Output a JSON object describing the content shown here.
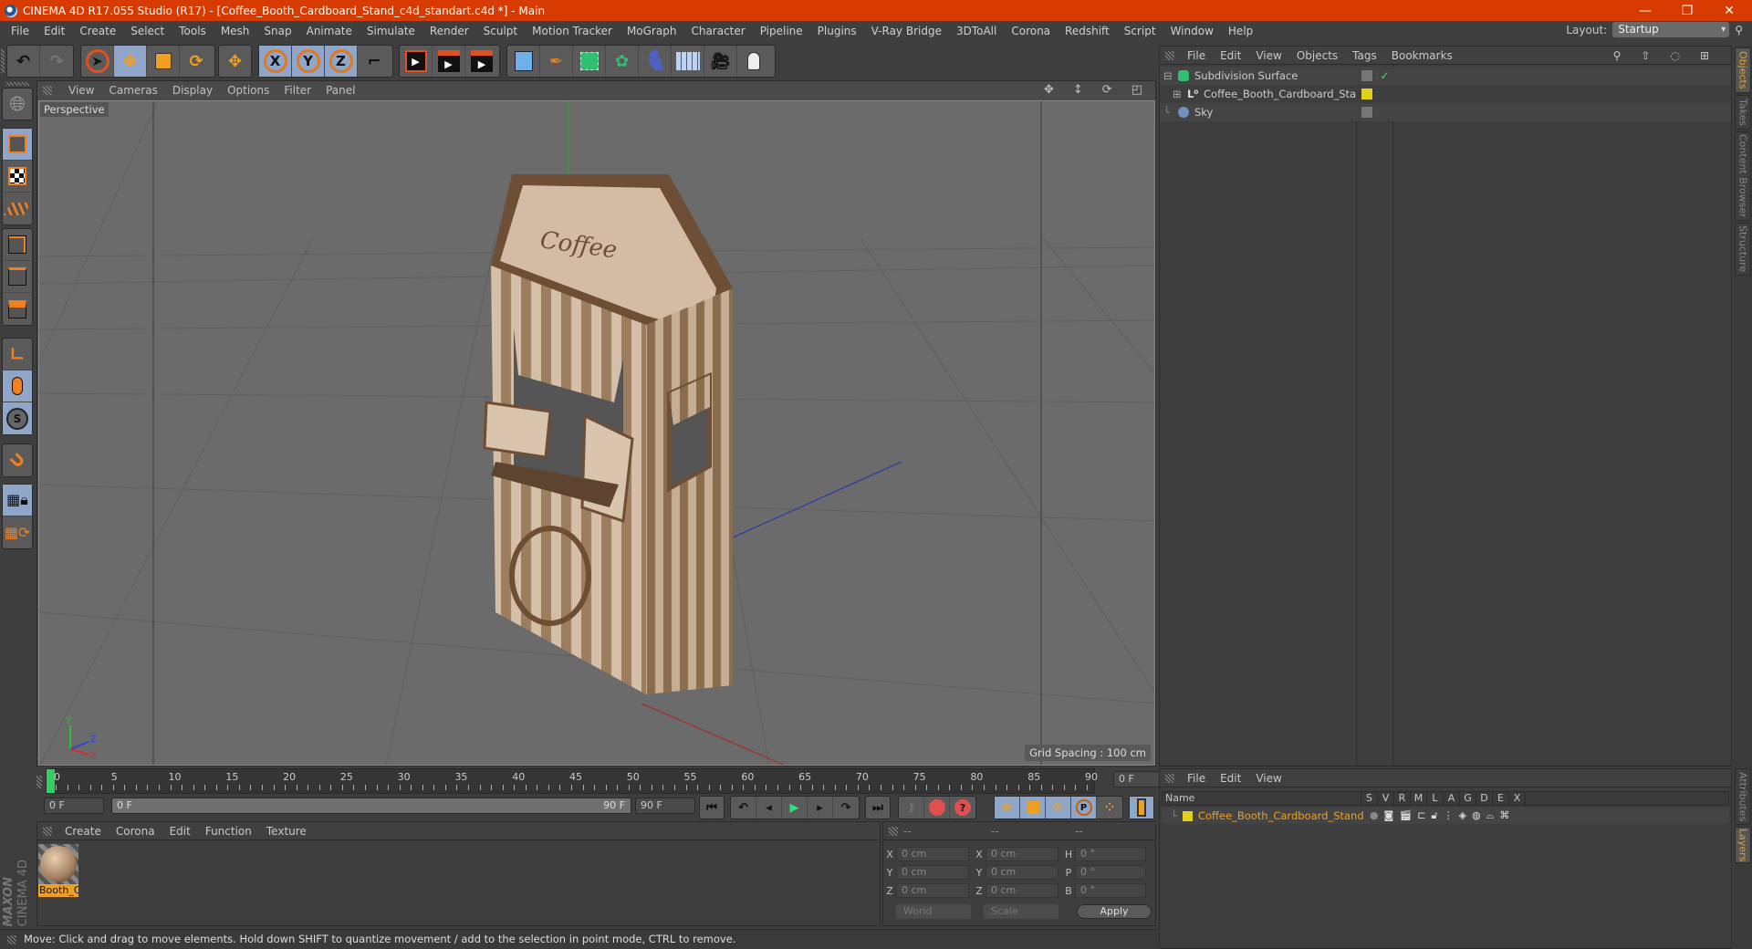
{
  "window": {
    "title": "CINEMA 4D R17.055 Studio (R17) - [Coffee_Booth_Cardboard_Stand_c4d_standart.c4d *] - Main",
    "controls": {
      "minimize": "—",
      "restore": "❐",
      "close": "✕"
    }
  },
  "menubar": [
    "File",
    "Edit",
    "Create",
    "Select",
    "Tools",
    "Mesh",
    "Snap",
    "Animate",
    "Simulate",
    "Render",
    "Sculpt",
    "Motion Tracker",
    "MoGraph",
    "Character",
    "Pipeline",
    "Plugins",
    "V-Ray Bridge",
    "3DToAll",
    "Corona",
    "Redshift",
    "Script",
    "Window",
    "Help"
  ],
  "layout": {
    "label": "Layout:",
    "value": "Startup"
  },
  "toolbar": {
    "history": [
      "undo-icon",
      "redo-icon"
    ],
    "modes": [
      "select-icon",
      "move-icon",
      "scale-icon",
      "rotate-icon",
      "last-tool-icon"
    ],
    "axes": [
      "X",
      "Y",
      "Z",
      "coordinate-system-icon"
    ],
    "render": [
      "render-view-icon",
      "render-picture-viewer-icon",
      "render-settings-icon"
    ],
    "create": [
      "cube-icon",
      "pen-icon",
      "subdivision-icon",
      "cloner-icon",
      "deformer-icon",
      "floor-icon",
      "camera-icon",
      "light-icon"
    ]
  },
  "left_tools": [
    "make-editable-icon",
    "model-mode-icon",
    "texture-mode-icon",
    "workplane-icon",
    "points-mode-icon",
    "edges-mode-icon",
    "polygons-mode-icon",
    "axis-mode-icon",
    "tweak-mode-icon",
    "snap-icon",
    "magnet-icon",
    "lock-workplane-icon",
    "workplane-rotate-icon"
  ],
  "viewport": {
    "menu": [
      "View",
      "Cameras",
      "Display",
      "Options",
      "Filter",
      "Panel"
    ],
    "label": "Perspective",
    "grid_spacing": "Grid Spacing : 100 cm",
    "axis_labels": {
      "x": "X",
      "y": "Y",
      "z": "Z"
    }
  },
  "timeline": {
    "ticks": [
      "0",
      "5",
      "10",
      "15",
      "20",
      "25",
      "30",
      "35",
      "40",
      "45",
      "50",
      "55",
      "60",
      "65",
      "70",
      "75",
      "80",
      "85",
      "90"
    ],
    "current_frame": "0 F",
    "start_field": "0 F",
    "range_start": "0 F",
    "range_end": "90 F",
    "end_field": "90 F"
  },
  "material_panel": {
    "menu": [
      "Create",
      "Corona",
      "Edit",
      "Function",
      "Texture"
    ],
    "materials": [
      {
        "name": "Booth_C"
      }
    ]
  },
  "coords": {
    "headers": [
      "--",
      "--",
      "--"
    ],
    "rows": [
      {
        "l1": "X",
        "v1": "0 cm",
        "l2": "X",
        "v2": "0 cm",
        "l3": "H",
        "v3": "0 °"
      },
      {
        "l1": "Y",
        "v1": "0 cm",
        "l2": "Y",
        "v2": "0 cm",
        "l3": "P",
        "v3": "0 °"
      },
      {
        "l1": "Z",
        "v1": "0 cm",
        "l2": "Z",
        "v2": "0 cm",
        "l3": "B",
        "v3": "0 °"
      }
    ],
    "space": "World",
    "mode": "Scale",
    "apply": "Apply"
  },
  "objects_panel": {
    "menu": [
      "File",
      "Edit",
      "View",
      "Objects",
      "Tags",
      "Bookmarks"
    ],
    "items": [
      {
        "name": "Subdivision Surface",
        "depth": 0,
        "expand": "⊟"
      },
      {
        "name": "Coffee_Booth_Cardboard_Stand",
        "depth": 1,
        "expand": "⊞"
      },
      {
        "name": "Sky",
        "depth": 0,
        "expand": ""
      }
    ]
  },
  "layers_panel": {
    "menu": [
      "File",
      "Edit",
      "View"
    ],
    "columns": [
      "Name",
      "S",
      "V",
      "R",
      "M",
      "L",
      "A",
      "G",
      "D",
      "E",
      "X"
    ],
    "rows": [
      {
        "name": "Coffee_Booth_Cardboard_Stand",
        "color": "#e0d020"
      }
    ]
  },
  "side_tabs": {
    "top": [
      "Objects",
      "Takes",
      "Content Browser",
      "Structure"
    ],
    "bottom": [
      "Attributes",
      "Layers"
    ]
  },
  "status": "Move: Click and drag to move elements. Hold down SHIFT to quantize movement / add to the selection in point mode, CTRL to remove.",
  "brand": {
    "maxon": "MAXON",
    "product": "CINEMA 4D"
  },
  "colors": {
    "titlebar": "#d83b01",
    "accent": "#f0a020",
    "active_button": "#8fa6c9"
  }
}
